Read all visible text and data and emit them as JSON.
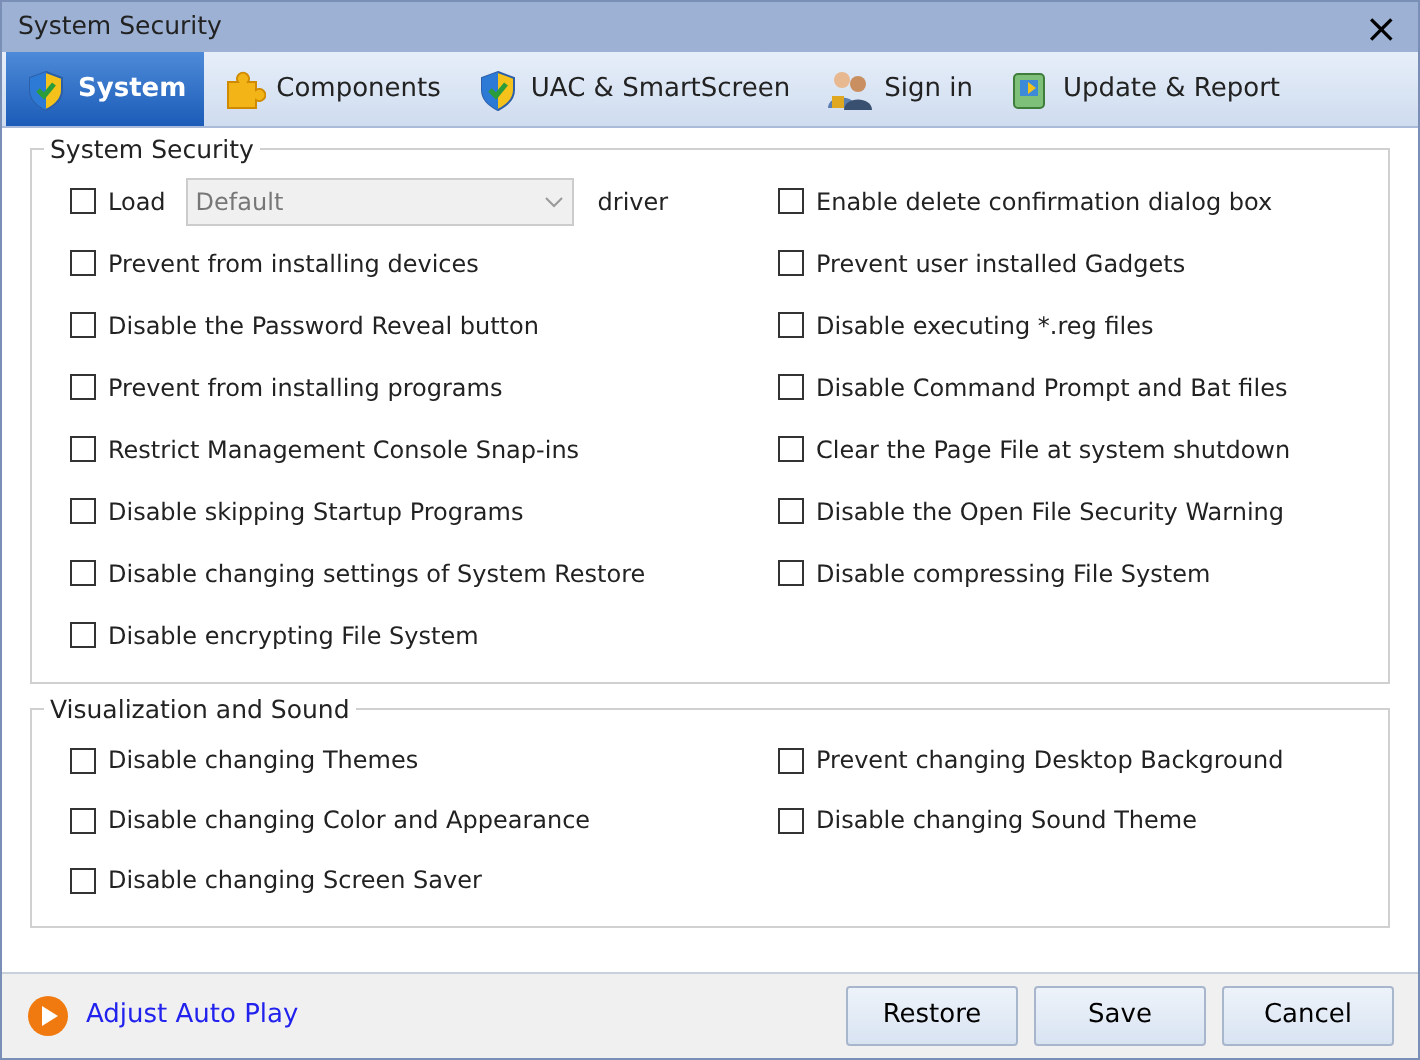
{
  "window": {
    "title": "System Security",
    "close": "×"
  },
  "tabs": [
    {
      "label": "System",
      "selected": true
    },
    {
      "label": "Components",
      "selected": false
    },
    {
      "label": "UAC & SmartScreen",
      "selected": false
    },
    {
      "label": "Sign in",
      "selected": false
    },
    {
      "label": "Update & Report",
      "selected": false
    }
  ],
  "groups": [
    {
      "title": "System Security",
      "columns": [
        [
          {
            "kind": "select",
            "label": "Load",
            "checked": false,
            "select": {
              "value": "Default",
              "disabled": true
            },
            "suffix": "driver"
          },
          {
            "kind": "check",
            "label": "Prevent from installing devices",
            "checked": false
          },
          {
            "kind": "check",
            "label": "Disable the Password Reveal button",
            "checked": false
          },
          {
            "kind": "check",
            "label": "Prevent from installing programs",
            "checked": false
          },
          {
            "kind": "check",
            "label": "Restrict Management Console Snap-ins",
            "checked": false
          },
          {
            "kind": "check",
            "label": "Disable skipping Startup Programs",
            "checked": false
          },
          {
            "kind": "check",
            "label": "Disable changing settings of System Restore",
            "checked": false
          },
          {
            "kind": "check",
            "label": "Disable encrypting File System",
            "checked": false
          }
        ],
        [
          {
            "kind": "check",
            "label": "Enable delete confirmation dialog box",
            "checked": false
          },
          {
            "kind": "check",
            "label": "Prevent user installed Gadgets",
            "checked": false
          },
          {
            "kind": "check",
            "label": "Disable executing *.reg files",
            "checked": false
          },
          {
            "kind": "check",
            "label": "Disable Command Prompt and Bat files",
            "checked": false
          },
          {
            "kind": "check",
            "label": "Clear the Page File at system shutdown",
            "checked": false
          },
          {
            "kind": "check",
            "label": "Disable the Open File Security Warning",
            "checked": false
          },
          {
            "kind": "check",
            "label": "Disable compressing File System",
            "checked": false
          }
        ]
      ]
    },
    {
      "title": "Visualization and Sound",
      "columns": [
        [
          {
            "kind": "check",
            "label": "Disable changing Themes",
            "checked": false
          },
          {
            "kind": "check",
            "label": "Disable changing Color and Appearance",
            "checked": false
          },
          {
            "kind": "check",
            "label": "Disable changing Screen Saver",
            "checked": false
          }
        ],
        [
          {
            "kind": "check",
            "label": "Prevent changing Desktop Background",
            "checked": false
          },
          {
            "kind": "check",
            "label": "Disable changing Sound Theme",
            "checked": false
          }
        ]
      ]
    }
  ],
  "footer": {
    "link": "Adjust Auto Play",
    "buttons": [
      "Restore",
      "Save",
      "Cancel"
    ]
  }
}
